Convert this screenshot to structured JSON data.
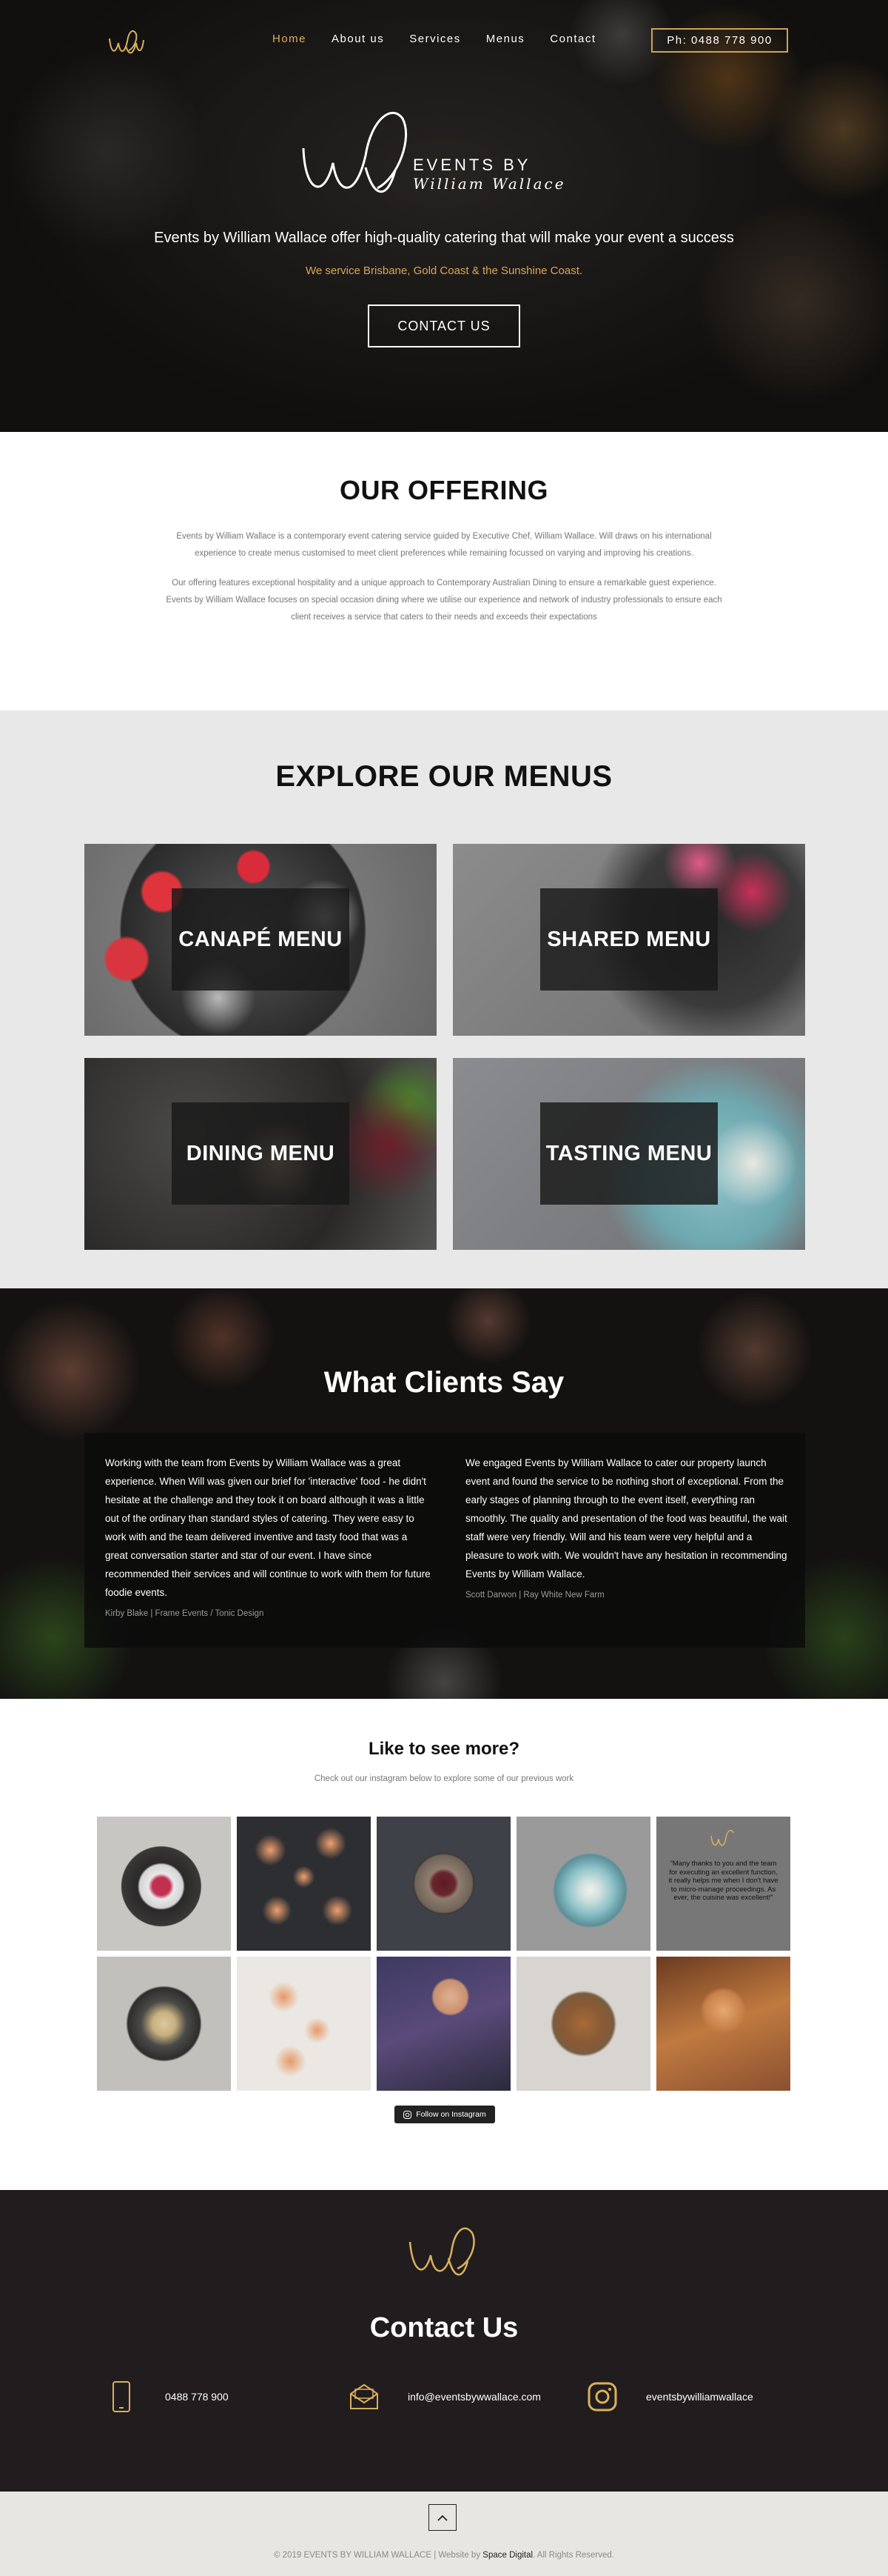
{
  "nav": {
    "items": [
      "Home",
      "About us",
      "Services",
      "Menus",
      "Contact"
    ],
    "active_index": 0,
    "phone": "Ph: 0488 778 900"
  },
  "hero": {
    "brand_top": "EVENTS BY",
    "brand_bottom": "William Wallace",
    "tagline": "Events by William Wallace offer high-quality catering that will make your event a success",
    "service_area": "We service Brisbane, Gold Coast & the Sunshine Coast.",
    "cta": "CONTACT US"
  },
  "offering": {
    "title": "OUR OFFERING",
    "p1": "Events by William Wallace is a contemporary event catering service guided by Executive Chef, William Wallace. Will draws on his international experience to create menus customised to meet client preferences while remaining focussed on varying and improving his creations.",
    "p2": "Our offering features exceptional hospitality and a unique approach to Contemporary Australian Dining to ensure a remarkable guest experience. Events by William Wallace focuses on special occasion dining where we utilise our experience and network of industry professionals to ensure each client receives a service that caters to their needs and exceeds their expectations"
  },
  "menus": {
    "title": "EXPLORE OUR MENUS",
    "cards": [
      "CANAPÉ MENU",
      "SHARED MENU",
      "DINING MENU",
      "TASTING MENU"
    ]
  },
  "testimonials": {
    "title": "What Clients Say",
    "items": [
      {
        "text": "Working with the team from Events by William Wallace was a great experience. When Will was given our brief for 'interactive' food - he didn't hesitate at the challenge and they took it on board although it was a little out of the ordinary than standard styles of catering. They were easy to work with and the team delivered inventive and tasty food that was a great conversation starter and star of our event. I have since recommended their services and will continue to work with them for future foodie events.",
        "author": "Kirby Blake | Frame Events / Tonic Design"
      },
      {
        "text": "We engaged Events by William Wallace to cater our property launch event and found the service to be nothing short of exceptional. From the early stages of planning through to the event itself, everything ran smoothly. The quality and presentation of the food was beautiful, the wait staff were very friendly. Will and his team were very helpful and a pleasure to work with. We wouldn't have any hesitation in recommending Events by William Wallace.",
        "author": "Scott Darwon | Ray White New Farm"
      }
    ]
  },
  "instagram": {
    "title": "Like to see more?",
    "subtitle": "Check out our instagram below to explore some of our previous work",
    "quote_tile": "\"Many thanks to you and the team for executing an excellent function, it really helps me when I don't have to micro-manage proceedings.  As ever, the cuisine was excellent!\"",
    "follow_label": "Follow on Instagram"
  },
  "contact": {
    "title": "Contact Us",
    "phone": "0488 778 900",
    "email": "info@eventsbywwallace.com",
    "instagram": "eventsbywilliamwallace"
  },
  "footer": {
    "copyright_prefix": "© 2019 EVENTS BY WILLIAM WALLACE | Website by",
    "agency": "Space Digital",
    "copyright_suffix": ". All Rights Reserved."
  },
  "colors": {
    "accent_gold": "#d8b15c",
    "dark_bg": "#211d1e",
    "light_bg": "#e8e8e8",
    "footer_bg": "#e8e6e1"
  },
  "icons": [
    "logo-monogram",
    "phone-icon",
    "mail-icon",
    "instagram-icon",
    "chevron-up-icon"
  ]
}
